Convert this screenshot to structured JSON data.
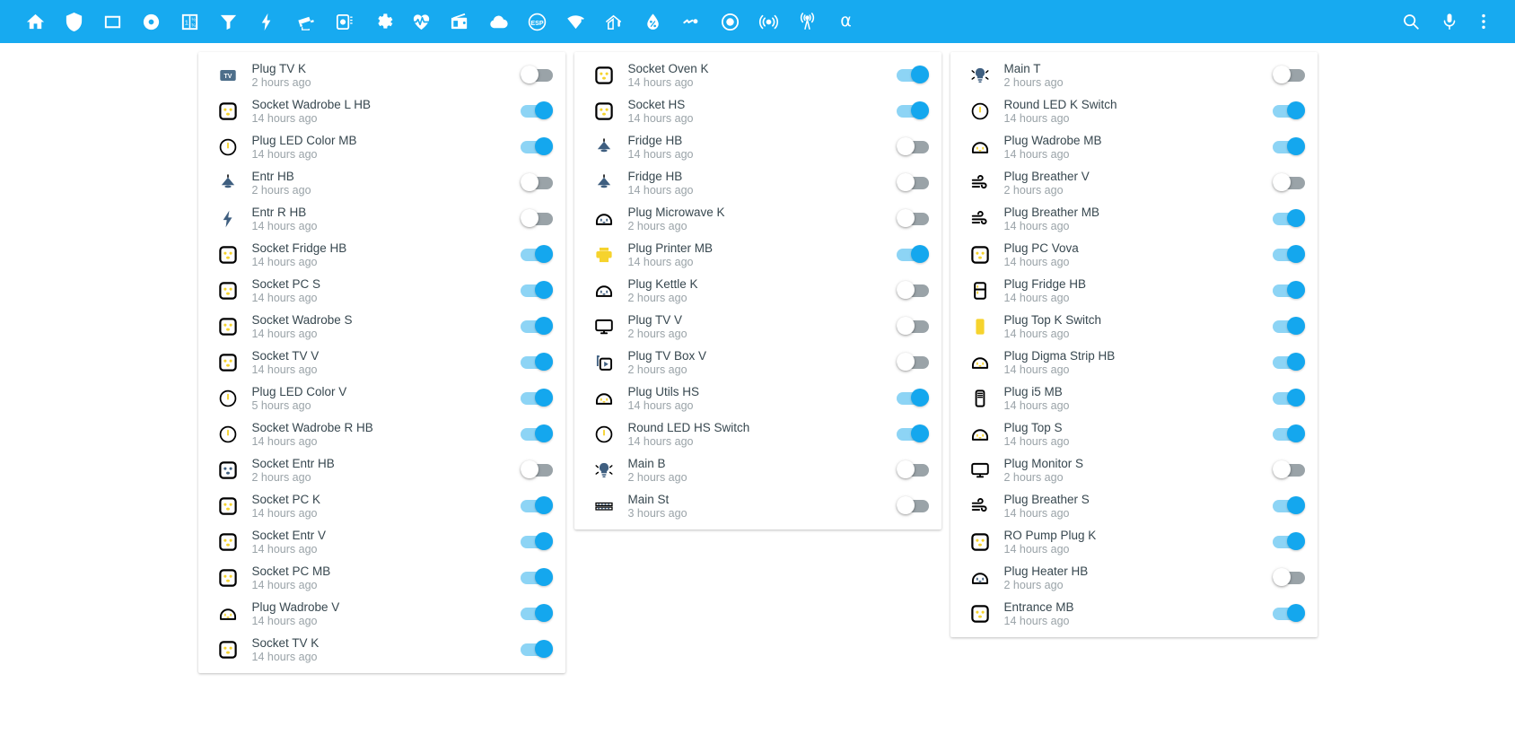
{
  "appbar": {
    "background": "#17aaf0",
    "left_icons": [
      {
        "name": "home-icon",
        "glyph": "home"
      },
      {
        "name": "shield-icon",
        "glyph": "shield"
      },
      {
        "name": "square-outline-icon",
        "glyph": "square"
      },
      {
        "name": "record-circle-icon",
        "glyph": "record"
      },
      {
        "name": "meter-icon",
        "glyph": "meter"
      },
      {
        "name": "filter-icon",
        "glyph": "filter"
      },
      {
        "name": "flash-icon",
        "glyph": "flash"
      },
      {
        "name": "cctv-icon",
        "glyph": "cctv"
      },
      {
        "name": "camera-note-icon",
        "glyph": "cameranote"
      },
      {
        "name": "gear-icon",
        "glyph": "gear"
      },
      {
        "name": "heart-pulse-icon",
        "glyph": "heartpulse"
      },
      {
        "name": "radio-icon",
        "glyph": "radio"
      },
      {
        "name": "cloud-icon",
        "glyph": "cloud"
      },
      {
        "name": "esp-icon",
        "glyph": "esp",
        "label": "ESP"
      },
      {
        "name": "wifi-alert-icon",
        "glyph": "wifialert"
      },
      {
        "name": "home-thermometer-icon",
        "glyph": "homethermo"
      },
      {
        "name": "water-percent-icon",
        "glyph": "waterpercent"
      },
      {
        "name": "toggle-switch-icon",
        "glyph": "switch"
      },
      {
        "name": "record-outline-icon",
        "glyph": "recordoutline"
      },
      {
        "name": "access-point-icon",
        "glyph": "accesspoint"
      },
      {
        "name": "broadcast-icon",
        "glyph": "broadcast"
      },
      {
        "name": "alpha-icon",
        "glyph": "alpha",
        "label": "α"
      }
    ],
    "right_icons": [
      {
        "name": "search-icon",
        "glyph": "search"
      },
      {
        "name": "microphone-icon",
        "glyph": "mic"
      },
      {
        "name": "overflow-menu-icon",
        "glyph": "dots"
      }
    ]
  },
  "columns": [
    {
      "id": "column-1",
      "items": [
        {
          "title": "Plug TV K",
          "subtitle": "2 hours ago",
          "state": "off",
          "icon": "tv-badge-icon",
          "color": "#4d6e8a"
        },
        {
          "title": "Socket Wadrobe L HB",
          "subtitle": "14 hours ago",
          "state": "on",
          "icon": "socket-icon",
          "color": "#f6d32d"
        },
        {
          "title": "Plug LED Color MB",
          "subtitle": "14 hours ago",
          "state": "on",
          "icon": "power-ring-icon",
          "color": "#f6d32d"
        },
        {
          "title": "Entr HB",
          "subtitle": "2 hours ago",
          "state": "off",
          "icon": "ceiling-light-icon",
          "color": "#3f5f80"
        },
        {
          "title": "Entr R HB",
          "subtitle": "14 hours ago",
          "state": "off",
          "icon": "flash-icon",
          "color": "#3f5f80"
        },
        {
          "title": "Socket Fridge HB",
          "subtitle": "14 hours ago",
          "state": "on",
          "icon": "socket-icon",
          "color": "#f6d32d"
        },
        {
          "title": "Socket PC S",
          "subtitle": "14 hours ago",
          "state": "on",
          "icon": "socket-icon",
          "color": "#f6d32d"
        },
        {
          "title": "Socket Wadrobe S",
          "subtitle": "14 hours ago",
          "state": "on",
          "icon": "socket-icon",
          "color": "#f6d32d"
        },
        {
          "title": "Socket TV V",
          "subtitle": "14 hours ago",
          "state": "on",
          "icon": "socket-icon",
          "color": "#f6d32d"
        },
        {
          "title": "Plug LED Color V",
          "subtitle": "5 hours ago",
          "state": "on",
          "icon": "power-ring-icon",
          "color": "#f6d32d"
        },
        {
          "title": "Socket Wadrobe R HB",
          "subtitle": "14 hours ago",
          "state": "on",
          "icon": "power-ring-icon",
          "color": "#f6d32d"
        },
        {
          "title": "Socket Entr HB",
          "subtitle": "2 hours ago",
          "state": "off",
          "icon": "socket-icon",
          "color": "#3f5f80"
        },
        {
          "title": "Socket PC K",
          "subtitle": "14 hours ago",
          "state": "on",
          "icon": "socket-icon",
          "color": "#f6d32d"
        },
        {
          "title": "Socket Entr V",
          "subtitle": "14 hours ago",
          "state": "on",
          "icon": "socket-icon",
          "color": "#f6d32d"
        },
        {
          "title": "Socket PC MB",
          "subtitle": "14 hours ago",
          "state": "on",
          "icon": "socket-icon",
          "color": "#f6d32d"
        },
        {
          "title": "Plug Wadrobe V",
          "subtitle": "14 hours ago",
          "state": "on",
          "icon": "power-strip-icon",
          "color": "#f6d32d"
        },
        {
          "title": "Socket TV K",
          "subtitle": "14 hours ago",
          "state": "on",
          "icon": "socket-icon",
          "color": "#f6d32d"
        }
      ]
    },
    {
      "id": "column-2",
      "items": [
        {
          "title": "Socket Oven K",
          "subtitle": "14 hours ago",
          "state": "on",
          "icon": "socket-icon",
          "color": "#f6d32d"
        },
        {
          "title": "Socket HS",
          "subtitle": "14 hours ago",
          "state": "on",
          "icon": "socket-icon",
          "color": "#f6d32d"
        },
        {
          "title": "Fridge HB",
          "subtitle": "14 hours ago",
          "state": "off",
          "icon": "ceiling-light-icon",
          "color": "#3f5f80"
        },
        {
          "title": "Fridge HB",
          "subtitle": "14 hours ago",
          "state": "off",
          "icon": "ceiling-light-icon",
          "color": "#3f5f80"
        },
        {
          "title": "Plug Microwave K",
          "subtitle": "2 hours ago",
          "state": "off",
          "icon": "power-strip-icon",
          "color": "#3f5f80"
        },
        {
          "title": "Plug Printer MB",
          "subtitle": "14 hours ago",
          "state": "on",
          "icon": "printer-icon",
          "color": "#f6d32d"
        },
        {
          "title": "Plug Kettle K",
          "subtitle": "2 hours ago",
          "state": "off",
          "icon": "power-strip-icon",
          "color": "#3f5f80"
        },
        {
          "title": "Plug TV V",
          "subtitle": "2 hours ago",
          "state": "off",
          "icon": "monitor-icon",
          "color": "#3f5f80"
        },
        {
          "title": "Plug TV Box V",
          "subtitle": "2 hours ago",
          "state": "off",
          "icon": "tvbox-icon",
          "color": "#3f5f80"
        },
        {
          "title": "Plug Utils HS",
          "subtitle": "14 hours ago",
          "state": "on",
          "icon": "power-strip-icon",
          "color": "#f6d32d"
        },
        {
          "title": "Round LED HS Switch",
          "subtitle": "14 hours ago",
          "state": "on",
          "icon": "power-ring-icon",
          "color": "#f6d32d"
        },
        {
          "title": "Main B",
          "subtitle": "2 hours ago",
          "state": "off",
          "icon": "bulb-icon",
          "color": "#3f5f80"
        },
        {
          "title": "Main St",
          "subtitle": "3 hours ago",
          "state": "off",
          "icon": "led-strip-icon",
          "color": "#3f5f80"
        }
      ]
    },
    {
      "id": "column-3",
      "items": [
        {
          "title": "Main T",
          "subtitle": "2 hours ago",
          "state": "off",
          "icon": "bulb-icon",
          "color": "#3f5f80"
        },
        {
          "title": "Round LED K Switch",
          "subtitle": "14 hours ago",
          "state": "on",
          "icon": "power-ring-icon",
          "color": "#f6d32d"
        },
        {
          "title": "Plug Wadrobe MB",
          "subtitle": "14 hours ago",
          "state": "on",
          "icon": "power-strip-icon",
          "color": "#f6d32d"
        },
        {
          "title": "Plug Breather V",
          "subtitle": "2 hours ago",
          "state": "off",
          "icon": "wind-icon",
          "color": "#3f5f80"
        },
        {
          "title": "Plug Breather MB",
          "subtitle": "14 hours ago",
          "state": "on",
          "icon": "wind-icon",
          "color": "#f6d32d"
        },
        {
          "title": "Plug PC Vova",
          "subtitle": "14 hours ago",
          "state": "on",
          "icon": "socket-icon",
          "color": "#f6d32d"
        },
        {
          "title": "Plug Fridge HB",
          "subtitle": "14 hours ago",
          "state": "on",
          "icon": "fridge-icon",
          "color": "#f6d32d"
        },
        {
          "title": "Plug Top K Switch",
          "subtitle": "14 hours ago",
          "state": "on",
          "icon": "tower-icon",
          "color": "#f6d32d"
        },
        {
          "title": "Plug Digma Strip HB",
          "subtitle": "14 hours ago",
          "state": "on",
          "icon": "power-strip-icon",
          "color": "#f6d32d"
        },
        {
          "title": "Plug i5 MB",
          "subtitle": "14 hours ago",
          "state": "on",
          "icon": "pc-tower-icon",
          "color": "#f6d32d"
        },
        {
          "title": "Plug Top S",
          "subtitle": "14 hours ago",
          "state": "on",
          "icon": "power-strip-icon",
          "color": "#f6d32d"
        },
        {
          "title": "Plug Monitor S",
          "subtitle": "2 hours ago",
          "state": "off",
          "icon": "monitor-icon",
          "color": "#3f5f80"
        },
        {
          "title": "Plug Breather S",
          "subtitle": "14 hours ago",
          "state": "on",
          "icon": "wind-icon",
          "color": "#f6d32d"
        },
        {
          "title": "RO Pump Plug K",
          "subtitle": "14 hours ago",
          "state": "on",
          "icon": "socket-icon",
          "color": "#f6d32d"
        },
        {
          "title": "Plug Heater HB",
          "subtitle": "2 hours ago",
          "state": "off",
          "icon": "power-strip-icon",
          "color": "#3f5f80"
        },
        {
          "title": "Entrance MB",
          "subtitle": "14 hours ago",
          "state": "on",
          "icon": "socket-icon",
          "color": "#f6d32d"
        }
      ]
    }
  ],
  "colors": {
    "accent": "#17aaf0",
    "toggle_on_track": "#8dd4f5",
    "toggle_on_thumb": "#14a7ee",
    "toggle_off_track": "#9aa3a8",
    "icon_yellow": "#f6d32d",
    "icon_blue": "#3f5f80",
    "title_text": "#37474f",
    "subtitle_text": "#9aa3a8"
  }
}
